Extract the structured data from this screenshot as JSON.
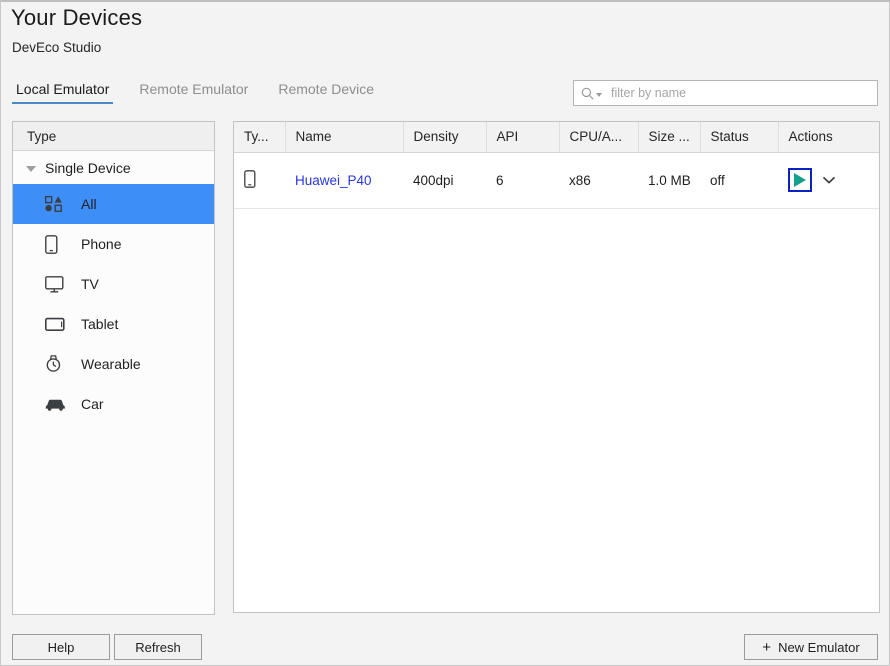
{
  "window": {
    "title": "Your Devices",
    "subtitle": "DevEco Studio",
    "background_color": "#f4f3f4"
  },
  "tabs": [
    {
      "label": "Local Emulator",
      "active": true
    },
    {
      "label": "Remote Emulator",
      "active": false
    },
    {
      "label": "Remote Device",
      "active": false
    }
  ],
  "search": {
    "placeholder": "filter by name",
    "value": "",
    "icon": "search-icon"
  },
  "type_panel": {
    "header": "Type",
    "group": {
      "label": "Single Device",
      "expanded": true
    },
    "items": [
      {
        "label": "All",
        "icon": "grid-shapes-icon",
        "selected": true
      },
      {
        "label": "Phone",
        "icon": "phone-icon",
        "selected": false
      },
      {
        "label": "TV",
        "icon": "tv-icon",
        "selected": false
      },
      {
        "label": "Tablet",
        "icon": "tablet-icon",
        "selected": false
      },
      {
        "label": "Wearable",
        "icon": "watch-icon",
        "selected": false
      },
      {
        "label": "Car",
        "icon": "car-icon",
        "selected": false
      }
    ],
    "selection_color": "#3d8ef7"
  },
  "device_table": {
    "columns": [
      "Ty...",
      "Name",
      "Density",
      "API",
      "CPU/A...",
      "Size ...",
      "Status",
      "Actions"
    ],
    "rows": [
      {
        "type_icon": "phone-icon",
        "name": "Huawei_P40",
        "density": "400dpi",
        "api": "6",
        "cpu": "x86",
        "size": "1.0 MB",
        "status": "off",
        "actions": {
          "run": "play-icon",
          "more": "chevron-down-icon"
        }
      }
    ],
    "link_color": "#2635e8",
    "play_color": "#12a18c",
    "focus_border_color": "#0822c4"
  },
  "footer": {
    "help_label": "Help",
    "refresh_label": "Refresh",
    "new_emulator_label": "New Emulator",
    "new_emulator_icon": "plus-icon"
  }
}
